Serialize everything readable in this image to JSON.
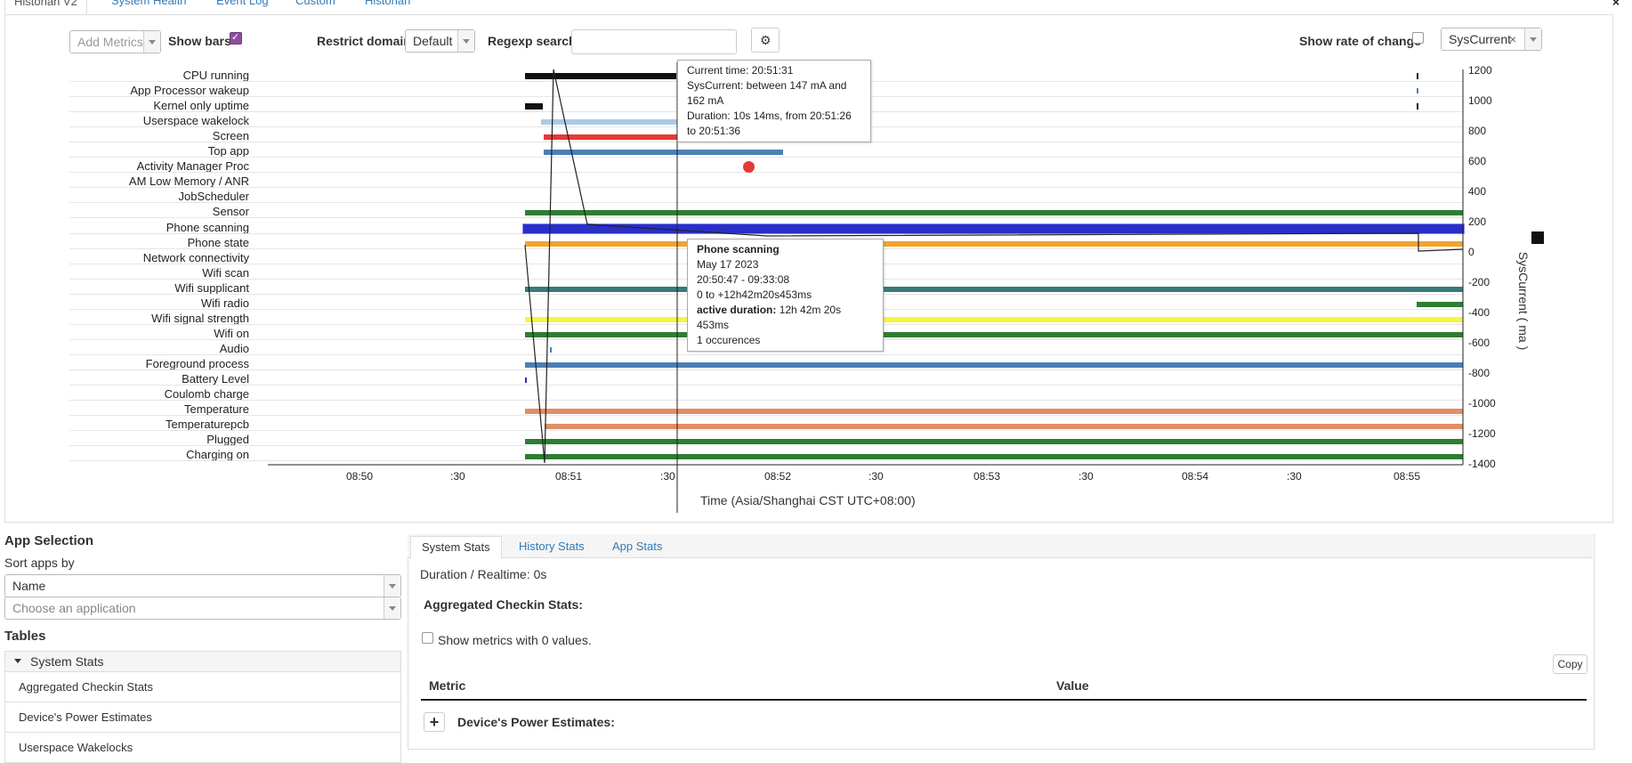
{
  "top_tabs": [
    "Historian V2",
    "System Health",
    "Event Log",
    "Custom",
    "Historian"
  ],
  "close_label": "×",
  "controls": {
    "add_metrics_placeholder": "Add Metrics",
    "show_bars_label": "Show bars",
    "restrict_domain_label": "Restrict domain",
    "restrict_domain_value": "Default",
    "regexp_label": "Regexp search",
    "regexp_value": "",
    "show_rate_label": "Show rate of change",
    "metric_tag": "SysCurrent",
    "metric_tag_remove": "×"
  },
  "row_labels": [
    "CPU running",
    "App Processor wakeup",
    "Kernel only uptime",
    "Userspace wakelock",
    "Screen",
    "Top app",
    "Activity Manager Proc",
    "AM Low Memory / ANR",
    "JobScheduler",
    "Sensor",
    "Phone scanning",
    "Phone state",
    "Network connectivity",
    "Wifi scan",
    "Wifi supplicant",
    "Wifi radio",
    "Wifi signal strength",
    "Wifi on",
    "Audio",
    "Foreground process",
    "Battery Level",
    "Coulomb charge",
    "Temperature",
    "Temperaturepcb",
    "Plugged",
    "Charging on"
  ],
  "colors": {
    "black": "#111111",
    "red": "#e53935",
    "steelblue": "#4a80b8",
    "lightblue": "#a9cbe9",
    "green": "#2e7d32",
    "blue": "#2a2fc9",
    "orange": "#f0a430",
    "teal": "#3a7a7a",
    "yellow": "#f5f542",
    "salmon": "#e08f66",
    "navy": "#2233aa"
  },
  "x_ticks": [
    "08:50",
    ":30",
    "08:51",
    ":30",
    "08:52",
    ":30",
    "08:53",
    ":30",
    "08:54",
    ":30",
    "08:55"
  ],
  "x_axis_label": "Time (Asia/Shanghai CST UTC+08:00)",
  "y_ticks": [
    "1200",
    "1000",
    "800",
    "600",
    "400",
    "200",
    "0",
    "-200",
    "-400",
    "-600",
    "-800",
    "-1000",
    "-1200",
    "-1400"
  ],
  "y_axis_label": "SysCurrent ( ma )",
  "tooltip_current": {
    "line1": "Current time: 20:51:31",
    "line2": "SysCurrent: between 147 mA and 162 mA",
    "line3": "Duration: 10s 14ms, from 20:51:26 to 20:51:36"
  },
  "tooltip_scan": {
    "title": "Phone scanning",
    "date": "May 17 2023",
    "range": "20:50:47 - 09:33:08",
    "offset": "0 to +12h42m20s453ms",
    "active_label": "active duration:",
    "active_value": "12h 42m 20s 453ms",
    "occ": "1 occurences"
  },
  "app_selection": {
    "title": "App Selection",
    "sort_label": "Sort apps by",
    "sort_value": "Name",
    "choose_placeholder": "Choose an application",
    "tables_title": "Tables",
    "system_stats": "System Stats",
    "items": [
      "Aggregated Checkin Stats",
      "Device's Power Estimates",
      "Userspace Wakelocks"
    ]
  },
  "stats_tabs": [
    "System Stats",
    "History Stats",
    "App Stats"
  ],
  "stats": {
    "duration": "Duration / Realtime: 0s",
    "aggregated_title": "Aggregated Checkin Stats:",
    "show_zero": "Show metrics with 0 values.",
    "copy": "Copy",
    "col_metric": "Metric",
    "col_value": "Value",
    "expand": "+",
    "power_estimates": "Device's Power Estimates:"
  }
}
